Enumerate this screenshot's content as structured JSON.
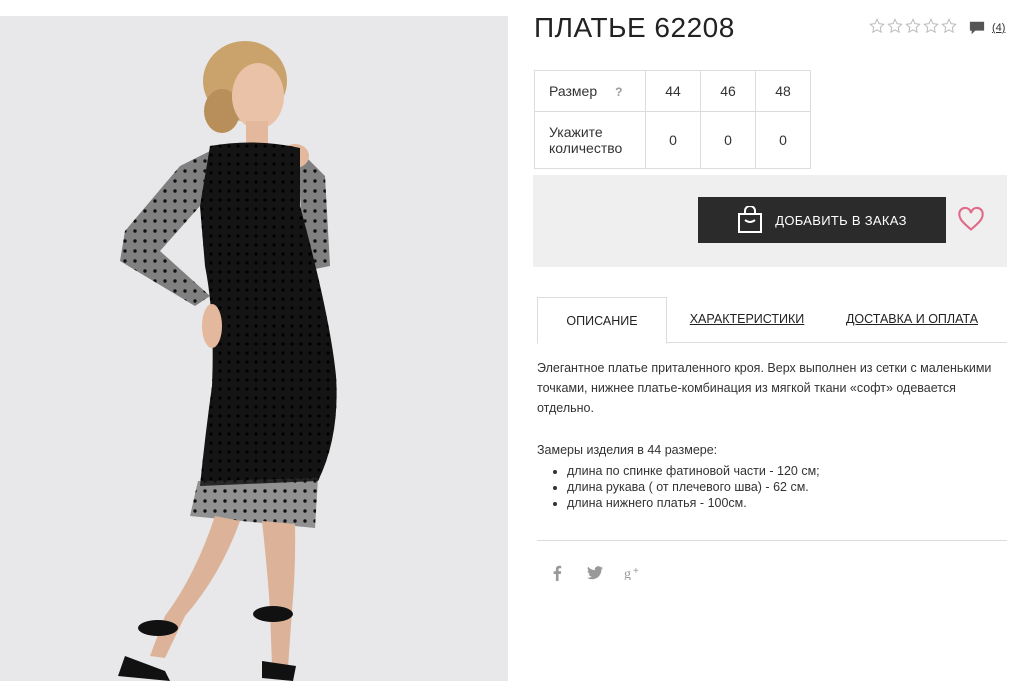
{
  "product": {
    "title": "ПЛАТЬЕ 62208",
    "rating_stars": 0,
    "rating_max": 5,
    "reviews_count": "(4)"
  },
  "size_table": {
    "size_label": "Размер",
    "help": "?",
    "sizes": [
      "44",
      "46",
      "48"
    ],
    "qty_label": "Укажите количество",
    "quantities": [
      "0",
      "0",
      "0"
    ]
  },
  "order": {
    "add_label": "ДОБАВИТЬ В ЗАКАЗ",
    "button_color": "#2b2b2b",
    "heart_color": "#e06a88"
  },
  "tabs": [
    {
      "label": "ОПИСАНИЕ",
      "active": true
    },
    {
      "label": "ХАРАКТЕРИСТИКИ",
      "active": false
    },
    {
      "label": "ДОСТАВКА И ОПЛАТА",
      "active": false
    }
  ],
  "description": {
    "text": "Элегантное платье приталенного кроя. Верх выполнен из сетки с маленькими точками, нижнее платье-комбинация из мягкой ткани «софт» одевается отдельно.",
    "measures_title": "Замеры изделия в 44 размере:",
    "measures": [
      "длина по спинке фатиновой части - 120 см;",
      "длина рукава ( от плечевого шва) - 62 см.",
      "длина нижнего платья - 100см."
    ]
  },
  "social": [
    "facebook-icon",
    "twitter-icon",
    "google-plus-icon"
  ]
}
